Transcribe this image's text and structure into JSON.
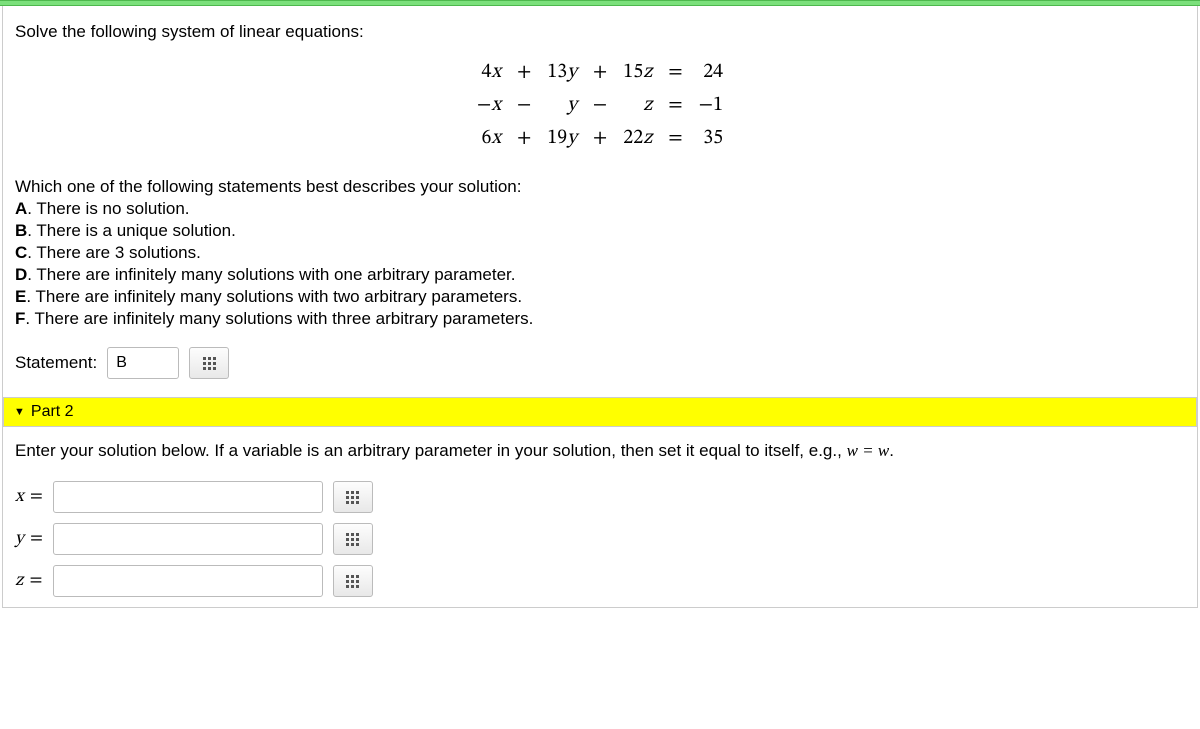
{
  "prompt": "Solve the following system of linear equations:",
  "equations": {
    "rows": [
      {
        "c1": "4x",
        "op1": "+",
        "c2": "13y",
        "op2": "+",
        "c3": "15z",
        "eq": "=",
        "rhs": "24"
      },
      {
        "c1": "−x",
        "op1": "−",
        "c2": "y",
        "op2": "−",
        "c3": "z",
        "eq": "=",
        "rhs": "−1"
      },
      {
        "c1": "6x",
        "op1": "+",
        "c2": "19y",
        "op2": "+",
        "c3": "22z",
        "eq": "=",
        "rhs": "35"
      }
    ]
  },
  "question": "Which one of the following statements best describes your solution:",
  "options": [
    {
      "letter": "A",
      "text": "There is no solution."
    },
    {
      "letter": "B",
      "text": "There is a unique solution."
    },
    {
      "letter": "C",
      "text": "There are 3 solutions."
    },
    {
      "letter": "D",
      "text": "There are infinitely many solutions with one arbitrary parameter."
    },
    {
      "letter": "E",
      "text": "There are infinitely many solutions with two arbitrary parameters."
    },
    {
      "letter": "F",
      "text": "There are infinitely many solutions with three arbitrary parameters."
    }
  ],
  "statement_label": "Statement:",
  "statement_value": "B",
  "part2": {
    "title": "Part 2",
    "hint_prefix": "Enter your solution below. If a variable is an arbitrary parameter in your solution, then set it equal to itself, e.g., ",
    "hint_math": "w = w",
    "hint_suffix": "."
  },
  "vars": [
    {
      "label": "x =",
      "value": ""
    },
    {
      "label": "y =",
      "value": ""
    },
    {
      "label": "z =",
      "value": ""
    }
  ]
}
